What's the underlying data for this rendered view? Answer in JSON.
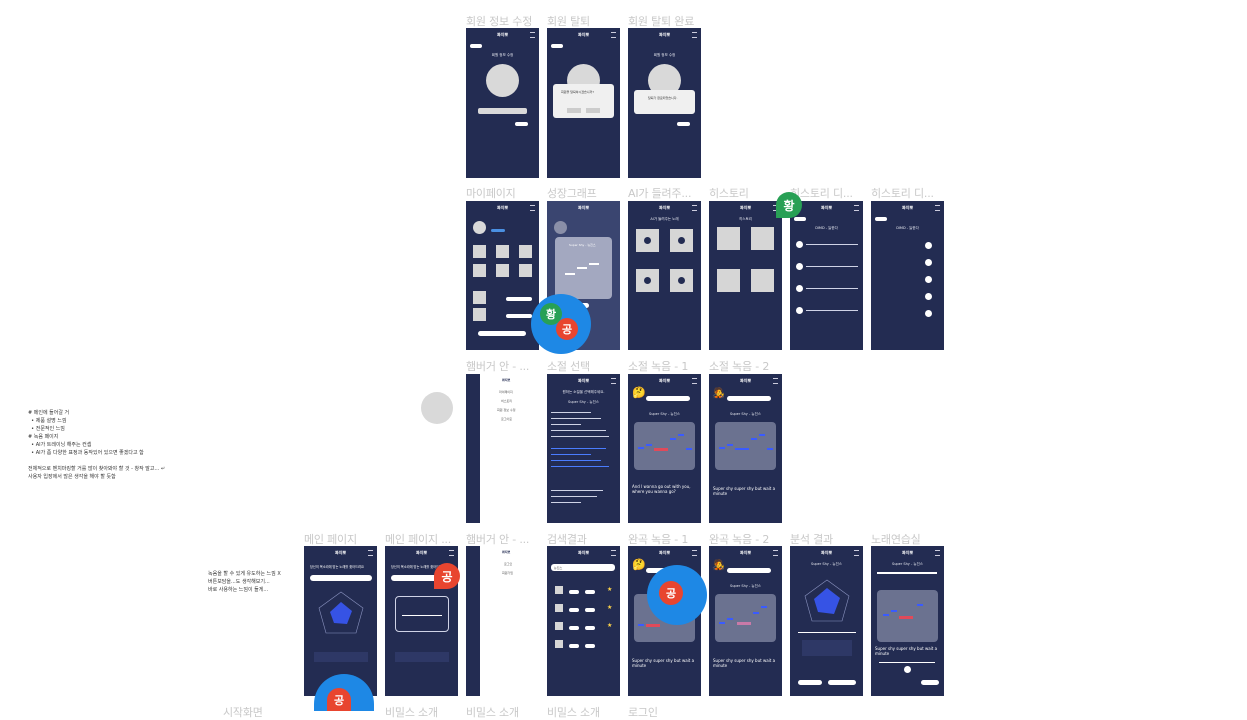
{
  "frames": {
    "member_edit": "회원 정보 수정",
    "member_leave": "회원 탈퇴",
    "member_leave_done": "회원 탈퇴 완료",
    "mypage": "마이페이지",
    "growth_graph": "성장그래프",
    "ai_recommend": "AI가 들려주...",
    "history": "히스토리",
    "history_d1": "히스토리 디...",
    "history_d2": "히스토리 디...",
    "hamburger1": "햄버거 안 - ...",
    "song_select": "소절 선택",
    "bar_record1": "소절 녹음 - 1",
    "bar_record2": "소절 녹음 - 2",
    "main_page": "메인 페이지",
    "main_page2": "메인 페이지 ...",
    "hamburger2": "햄버거 안 - ...",
    "search_result": "검색결과",
    "full_record1": "완곡 녹음 - 1",
    "full_record2": "완곡 녹음 - 2",
    "analysis_result": "분석 결과",
    "singing_practice": "노래연습실",
    "bottom1": "시작화면",
    "bottom2": "비밀스 소개",
    "bottom3": "비밀스 소개",
    "bottom4": "비밀스 소개",
    "bottom5": "로그인"
  },
  "app": {
    "logo": "콰지뽀",
    "edit_title": "회원 정보 수정",
    "leave_dialog": "회원을 탈퇴하시겠습니까?",
    "leave_done_dialog": "탈퇴가 완료되었습니다.",
    "ai_title": "AI가 들려주는 노래",
    "history_title": "히스토리",
    "history_detail_title": "DIMD - 늘한다",
    "song_select_title": "원하는 소절을 선택해주세요.",
    "song_name": "Super Shy - 뉴진스",
    "lyric1": "And I wanna go out with you, where you wanna go?",
    "lyric2": "Super shy super shy but wait a minute",
    "hamburger_items": [
      "마이페이지",
      "히스토리",
      "회원 정보 수정",
      "로그아웃"
    ],
    "hamburger2_items": [
      "로그인",
      "회원가입"
    ],
    "search_placeholder": "뉴진스",
    "main_title": "당신의 목소리에 맞는 노래를 찾아드려요"
  },
  "memo1": "# 메인에 들어갈 거\n  • 제품 설명 느낌\n  • 전문적인 느낌\n# 녹음 페이지\n  • AI가 트레이닝 해주는 컨셉\n  • AI가 좀 다양한 표정과 동작있어 있으면 좋겠다고 함\n\n전체적으로 벤치마킹할 거를 많이 찾아봐야 할 것 - 창작 말고... ↵\n사용자 입장에서 많은 생각을 해야 할 듯함",
  "memo2": "녹음을 할 수 있게 유도하는 느낌 X\n버튼보담을...도 생각해보기...\n바로 사용하는 느낌이 들게...",
  "cursors": {
    "hwang": "황",
    "gong": "공"
  }
}
